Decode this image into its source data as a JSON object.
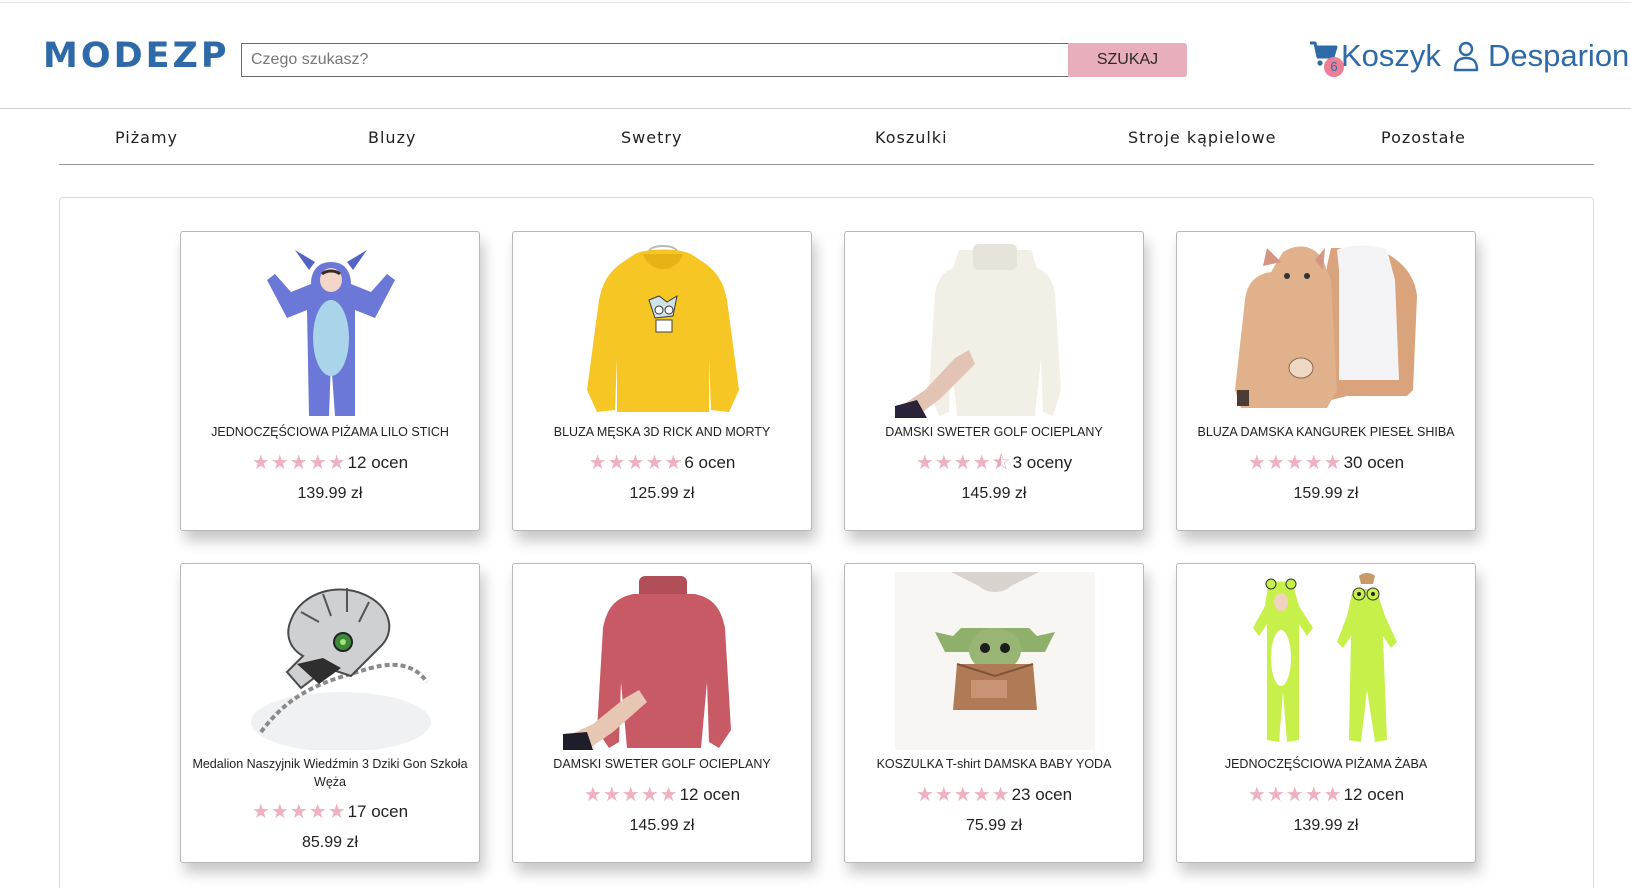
{
  "header": {
    "logo": "MODEZP",
    "search": {
      "placeholder": "Czego szukasz?",
      "value": "",
      "button_label": "SZUKAJ"
    },
    "cart": {
      "label": "Koszyk",
      "count": "6"
    },
    "user": {
      "name": "Desparion"
    }
  },
  "nav": {
    "items": [
      {
        "label": "Piżamy"
      },
      {
        "label": "Bluzy"
      },
      {
        "label": "Swetry"
      },
      {
        "label": "Koszulki"
      },
      {
        "label": "Stroje kąpielowe"
      },
      {
        "label": "Pozostałe"
      }
    ]
  },
  "products": [
    {
      "title": "JEDNOCZĘŚCIOWA PIŻAMA LILO STICH",
      "rating": 5,
      "reviews": "12 ocen",
      "price": "139.99 zł",
      "image": "blue-stitch-onesie"
    },
    {
      "title": "BLUZA MĘSKA 3D RICK AND MORTY",
      "rating": 5,
      "reviews": "6 ocen",
      "price": "125.99 zł",
      "image": "yellow-hoodie"
    },
    {
      "title": "DAMSKI SWETER GOLF OCIEPLANY",
      "rating": 4.5,
      "reviews": "3 oceny",
      "price": "145.99 zł",
      "image": "white-turtleneck"
    },
    {
      "title": "BLUZA DAMSKA KANGUREK PIESEŁ SHIBA",
      "rating": 5,
      "reviews": "30 ocen",
      "price": "159.99 zł",
      "image": "shiba-hoodie"
    },
    {
      "title": "Medalion Naszyjnik Wiedźmin 3 Dziki Gon Szkoła Węża",
      "rating": 5,
      "reviews": "17 ocen",
      "price": "85.99 zł",
      "image": "snake-medallion"
    },
    {
      "title": "DAMSKI SWETER GOLF OCIEPLANY",
      "rating": 5,
      "reviews": "12 ocen",
      "price": "145.99 zł",
      "image": "pink-turtleneck"
    },
    {
      "title": "KOSZULKA T-shirt DAMSKA BABY YODA",
      "rating": 5,
      "reviews": "23 ocen",
      "price": "75.99 zł",
      "image": "baby-yoda-tshirt"
    },
    {
      "title": "JEDNOCZĘŚCIOWA PIŻAMA ŻABA",
      "rating": 5,
      "reviews": "12 ocen",
      "price": "139.99 zł",
      "image": "green-frog-onesie"
    }
  ],
  "colors": {
    "brand": "#2f6aa8",
    "search_button": "#e9aebb",
    "star": "#efb1bf",
    "badge": "#ec7e96"
  },
  "icons": {
    "cart": "shopping-cart-icon",
    "user": "user-icon",
    "star": "star-icon"
  }
}
